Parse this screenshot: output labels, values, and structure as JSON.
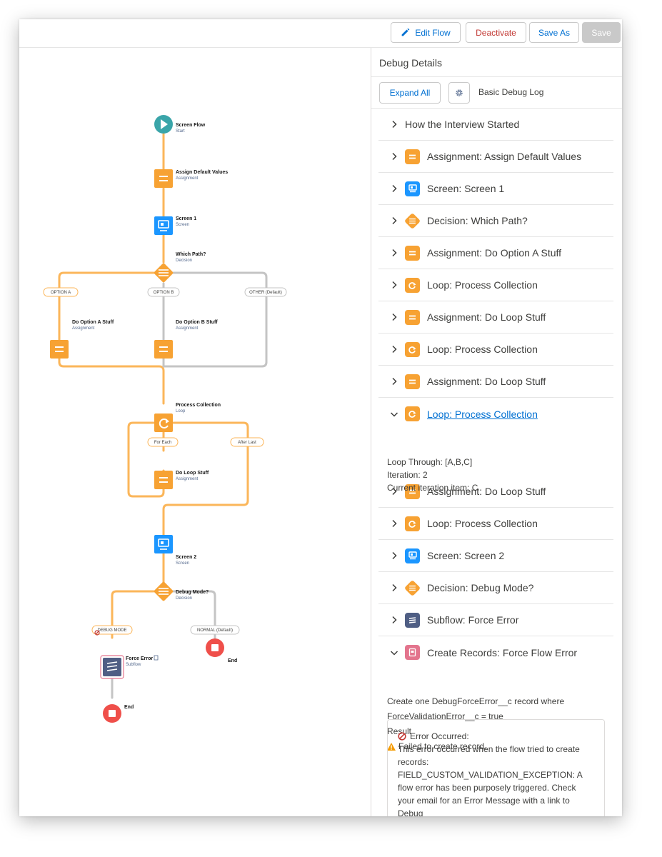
{
  "toolbar": {
    "edit_flow": "Edit Flow",
    "deactivate": "Deactivate",
    "save_as": "Save As",
    "save": "Save"
  },
  "flow": {
    "start": {
      "title": "Screen Flow",
      "sub": "Start"
    },
    "assign_defaults": {
      "title": "Assign Default Values",
      "sub": "Assignment"
    },
    "screen1": {
      "title": "Screen 1",
      "sub": "Screen"
    },
    "which_path": {
      "title": "Which Path?",
      "sub": "Decision"
    },
    "option_a": "OPTION A",
    "option_b": "OPTION B",
    "other": "OTHER (Default)",
    "do_a": {
      "title": "Do Option A Stuff",
      "sub": "Assignment"
    },
    "do_b": {
      "title": "Do Option B Stuff",
      "sub": "Assignment"
    },
    "process": {
      "title": "Process Collection",
      "sub": "Loop"
    },
    "for_each": "For Each",
    "after_last": "After Last",
    "do_loop": {
      "title": "Do Loop Stuff",
      "sub": "Assignment"
    },
    "screen2": {
      "title": "Screen 2",
      "sub": "Screen"
    },
    "debug_mode": {
      "title": "Debug Mode?",
      "sub": "Decision"
    },
    "debug_mode_label": "DEBUG MODE",
    "normal_label": "NORMAL (Default)",
    "force_error": {
      "title": "Force Error",
      "sub": "Subflow"
    },
    "end1": "End",
    "end2": "End"
  },
  "panel": {
    "title": "Debug Details",
    "expand_all": "Expand All",
    "log_label": "Basic Debug Log",
    "rows": [
      {
        "label": "How the Interview Started",
        "icon": "none"
      },
      {
        "label": "Assignment: Assign Default Values",
        "icon": "assignment-icon"
      },
      {
        "label": "Screen: Screen 1",
        "icon": "screen-icon"
      },
      {
        "label": "Decision: Which Path?",
        "icon": "decision-icon"
      },
      {
        "label": "Assignment: Do Option A Stuff",
        "icon": "assignment-icon"
      },
      {
        "label": "Loop: Process Collection",
        "icon": "loop-icon"
      },
      {
        "label": "Assignment: Do Loop Stuff",
        "icon": "assignment-icon"
      },
      {
        "label": "Loop: Process Collection",
        "icon": "loop-icon"
      },
      {
        "label": "Assignment: Do Loop Stuff",
        "icon": "assignment-icon"
      },
      {
        "label": "Loop: Process Collection",
        "icon": "loop-icon"
      },
      {
        "label": "Assignment: Do Loop Stuff",
        "icon": "assignment-icon"
      },
      {
        "label": "Loop: Process Collection",
        "icon": "loop-icon"
      },
      {
        "label": "Screen: Screen 2",
        "icon": "screen-icon"
      },
      {
        "label": "Decision: Debug Mode?",
        "icon": "decision-icon"
      },
      {
        "label": "Subflow: Force Error",
        "icon": "subflow-icon"
      },
      {
        "label": "Create Records: Force Flow Error",
        "icon": "create-records-icon"
      }
    ],
    "loop_details": {
      "loop_through": "Loop Through: [A,B,C]",
      "iteration": "Iteration: 2",
      "current_item": "Current iteration item: C"
    },
    "create_details": {
      "line1": "Create one DebugForceError__c record where",
      "line2": "ForceValidationError__c = true",
      "result": "Result",
      "failed": "Failed to create record."
    },
    "error": {
      "title": "Error Occurred:",
      "message": "This error occurred when the flow tried to create records: FIELD_CUSTOM_VALIDATION_EXCEPTION: A flow error has been purposely triggered. Check your email for an Error Message with a link to Debug"
    }
  },
  "colors": {
    "orange": "#f7a233",
    "blue": "#1b96ff",
    "teal": "#3aa5a9",
    "red": "#ef4f4a",
    "navy": "#4f5e84",
    "pink": "#e3748d",
    "link": "#0070d2",
    "path_orange": "#fbb65a",
    "path_grey": "#c4c4c4"
  }
}
